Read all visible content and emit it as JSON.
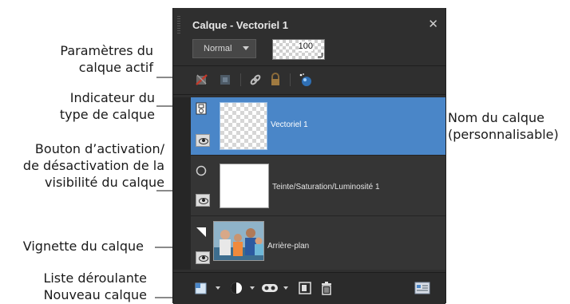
{
  "panel": {
    "title": "Calque - Vectoriel 1",
    "close_icon": "close-icon",
    "blend_mode": "Normal",
    "opacity": "100"
  },
  "toolbar": {
    "icons": [
      "delete-layer-icon",
      "link-mask-icon",
      "link-icon",
      "lock-icon",
      "layer-effects-icon"
    ]
  },
  "layers": [
    {
      "name": "Vectoriel 1",
      "type": "vector",
      "visible": true,
      "selected": true
    },
    {
      "name": "Teinte/Saturation/Luminosité 1",
      "type": "adjustment",
      "visible": true,
      "selected": false
    },
    {
      "name": "Arrière-plan",
      "type": "raster",
      "visible": true,
      "selected": false
    }
  ],
  "bottom_toolbar": {
    "icons": [
      "new-layer-icon",
      "new-adjustment-icon",
      "new-mask-icon",
      "new-group-icon",
      "delete-icon",
      "layer-properties-icon"
    ]
  },
  "callouts": {
    "active_layer_params": [
      "Paramètres du",
      "calque actif"
    ],
    "layer_type_indicator": [
      "Indicateur du",
      "type de calque"
    ],
    "visibility_toggle": [
      "Bouton d’activation/",
      "de désactivation de la",
      "visibilité du calque"
    ],
    "layer_thumbnail": [
      "Vignette du calque"
    ],
    "new_layer_dropdown": [
      "Liste déroulante",
      "Nouveau calque"
    ],
    "layer_name": [
      "Nom du calque",
      "(personnalisable)"
    ]
  },
  "colors": {
    "panel_bg": "#2f2f2f",
    "selected_layer": "#4a86c8",
    "arrow": "#8a8a8a"
  }
}
